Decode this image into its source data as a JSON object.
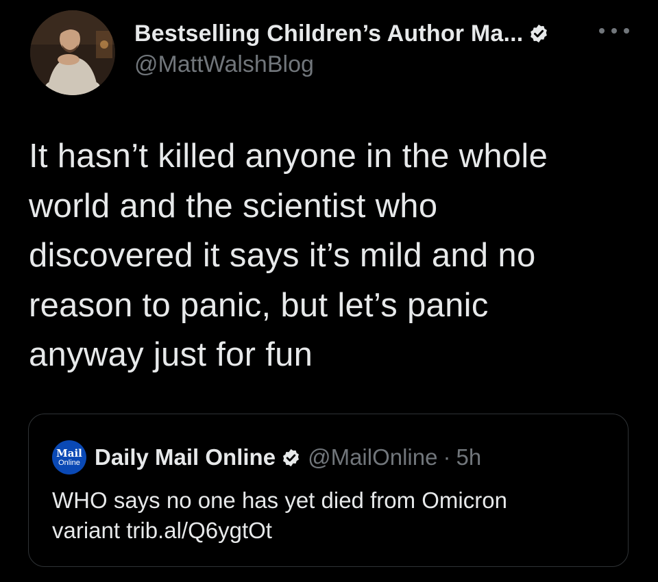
{
  "colors": {
    "background": "#000000",
    "text_primary": "#e7e9ea",
    "text_secondary": "#71767b",
    "verified_badge": "#e7e9ea",
    "quote_border": "#2f3336",
    "mail_online_brand": "#0a49b5"
  },
  "tweet": {
    "author": {
      "display_name": "Bestselling Children’s Author Ma...",
      "handle": "@MattWalshBlog",
      "verified_icon": "verified-badge-icon",
      "more_icon": "more-options-icon"
    },
    "text": "It hasn’t killed anyone in the whole\nworld and the scientist who\ndiscovered it says it’s mild and no\nreason to panic, but let’s panic\nanyway just for fun",
    "quoted": {
      "avatar_top": "Mail",
      "avatar_bottom": "Online",
      "display_name": "Daily Mail Online",
      "handle": "@MailOnline",
      "separator": "·",
      "time": "5h",
      "text": "WHO says no one has yet died from Omicron\nvariant trib.al/Q6ygtOt"
    }
  }
}
